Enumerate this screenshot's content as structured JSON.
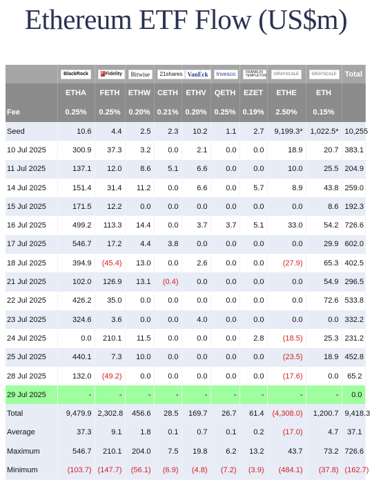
{
  "title": "Ethereum ETF Flow (US$m)",
  "header": {
    "logos": [
      {
        "icon": "blackrock-logo",
        "text": "BlackRock"
      },
      {
        "icon": "fidelity-logo",
        "text": "Fidelity"
      },
      {
        "icon": "bitwise-logo",
        "text": "Bitwise"
      },
      {
        "icon": "21shares-logo",
        "text": "21shares"
      },
      {
        "icon": "vaneck-logo",
        "text": "VanEck"
      },
      {
        "icon": "invesco-logo",
        "text": "Invesco"
      },
      {
        "icon": "franklin-templeton-logo",
        "text": "FRANKLIN TEMPLETON"
      },
      {
        "icon": "grayscale-logo",
        "text": "GRAYSCALE"
      },
      {
        "icon": "grayscale-logo",
        "text": "GRAYSCALE"
      }
    ],
    "total_label": "Total",
    "tickers": [
      "ETHA",
      "FETH",
      "ETHW",
      "CETH",
      "ETHV",
      "QETH",
      "EZET",
      "ETHE",
      "ETH"
    ],
    "fee_label": "Fee",
    "fees": [
      "0.25%",
      "0.25%",
      "0.20%",
      "0.21%",
      "0.20%",
      "0.25%",
      "0.19%",
      "2.50%",
      "0.15%"
    ]
  },
  "chart_data": {
    "type": "table",
    "title": "Ethereum ETF Flow (US$m)",
    "columns": [
      "",
      "ETHA",
      "FETH",
      "ETHW",
      "CETH",
      "ETHV",
      "QETH",
      "EZET",
      "ETHE",
      "ETH",
      "Total"
    ],
    "rows": [
      {
        "label": "Seed",
        "values": [
          "10.6",
          "4.4",
          "2.5",
          "2.3",
          "10.2",
          "1.1",
          "2.7",
          "9,199.3*",
          "1,022.5*",
          "10,255"
        ]
      },
      {
        "label": "10 Jul 2025",
        "values": [
          "300.9",
          "37.3",
          "3.2",
          "0.0",
          "2.1",
          "0.0",
          "0.0",
          "18.9",
          "20.7",
          "383.1"
        ]
      },
      {
        "label": "11 Jul 2025",
        "values": [
          "137.1",
          "12.0",
          "8.6",
          "5.1",
          "6.6",
          "0.0",
          "0.0",
          "10.0",
          "25.5",
          "204.9"
        ]
      },
      {
        "label": "14 Jul 2025",
        "values": [
          "151.4",
          "31.4",
          "11.2",
          "0.0",
          "6.6",
          "0.0",
          "5.7",
          "8.9",
          "43.8",
          "259.0"
        ]
      },
      {
        "label": "15 Jul 2025",
        "values": [
          "171.5",
          "12.2",
          "0.0",
          "0.0",
          "0.0",
          "0.0",
          "0.0",
          "0.0",
          "8.6",
          "192.3"
        ]
      },
      {
        "label": "16 Jul 2025",
        "values": [
          "499.2",
          "113.3",
          "14.4",
          "0.0",
          "3.7",
          "3.7",
          "5.1",
          "33.0",
          "54.2",
          "726.6"
        ]
      },
      {
        "label": "17 Jul 2025",
        "values": [
          "546.7",
          "17.2",
          "4.4",
          "3.8",
          "0.0",
          "0.0",
          "0.0",
          "0.0",
          "29.9",
          "602.0"
        ]
      },
      {
        "label": "18 Jul 2025",
        "values": [
          "394.9",
          "(45.4)",
          "13.0",
          "0.0",
          "2.6",
          "0.0",
          "0.0",
          "(27.9)",
          "65.3",
          "402.5"
        ]
      },
      {
        "label": "21 Jul 2025",
        "values": [
          "102.0",
          "126.9",
          "13.1",
          "(0.4)",
          "0.0",
          "0.0",
          "0.0",
          "0.0",
          "54.9",
          "296.5"
        ]
      },
      {
        "label": "22 Jul 2025",
        "values": [
          "426.2",
          "35.0",
          "0.0",
          "0.0",
          "0.0",
          "0.0",
          "0.0",
          "0.0",
          "72.6",
          "533.8"
        ]
      },
      {
        "label": "23 Jul 2025",
        "values": [
          "324.6",
          "3.6",
          "0.0",
          "0.0",
          "4.0",
          "0.0",
          "0.0",
          "0.0",
          "0.0",
          "332.2"
        ]
      },
      {
        "label": "24 Jul 2025",
        "values": [
          "0.0",
          "210.1",
          "11.5",
          "0.0",
          "0.0",
          "0.0",
          "2.8",
          "(18.5)",
          "25.3",
          "231.2"
        ]
      },
      {
        "label": "25 Jul 2025",
        "values": [
          "440.1",
          "7.3",
          "10.0",
          "0.0",
          "0.0",
          "0.0",
          "0.0",
          "(23.5)",
          "18.9",
          "452.8"
        ]
      },
      {
        "label": "28 Jul 2025",
        "values": [
          "132.0",
          "(49.2)",
          "0.0",
          "0.0",
          "0.0",
          "0.0",
          "0.0",
          "(17.6)",
          "0.0",
          "65.2"
        ]
      },
      {
        "label": "29 Jul 2025",
        "highlight": true,
        "values": [
          "-",
          "-",
          "-",
          "-",
          "-",
          "-",
          "-",
          "-",
          "-",
          "0.0"
        ]
      }
    ],
    "summary": [
      {
        "label": "Total",
        "values": [
          "9,479.9",
          "2,302.8",
          "456.6",
          "28.5",
          "169.7",
          "26.7",
          "61.4",
          "(4,308.0)",
          "1,200.7",
          "9,418.3"
        ]
      },
      {
        "label": "Average",
        "values": [
          "37.3",
          "9.1",
          "1.8",
          "0.1",
          "0.7",
          "0.1",
          "0.2",
          "(17.0)",
          "4.7",
          "37.1"
        ]
      },
      {
        "label": "Maximum",
        "values": [
          "546.7",
          "210.1",
          "204.0",
          "7.5",
          "19.8",
          "6.2",
          "13.2",
          "43.7",
          "73.2",
          "726.6"
        ]
      },
      {
        "label": "Minimum",
        "values": [
          "(103.7)",
          "(147.7)",
          "(56.1)",
          "(6.9)",
          "(4.8)",
          "(7.2)",
          "(3.9)",
          "(484.1)",
          "(37.8)",
          "(162.7)"
        ]
      }
    ]
  },
  "colors": {
    "title": "#2b3150",
    "header_light": "#a6a6a6",
    "header_dark": "#8c8c8c",
    "row_band": "#e8ecf7",
    "highlight_row": "#9eff9e",
    "negative": "#d21f1f"
  }
}
